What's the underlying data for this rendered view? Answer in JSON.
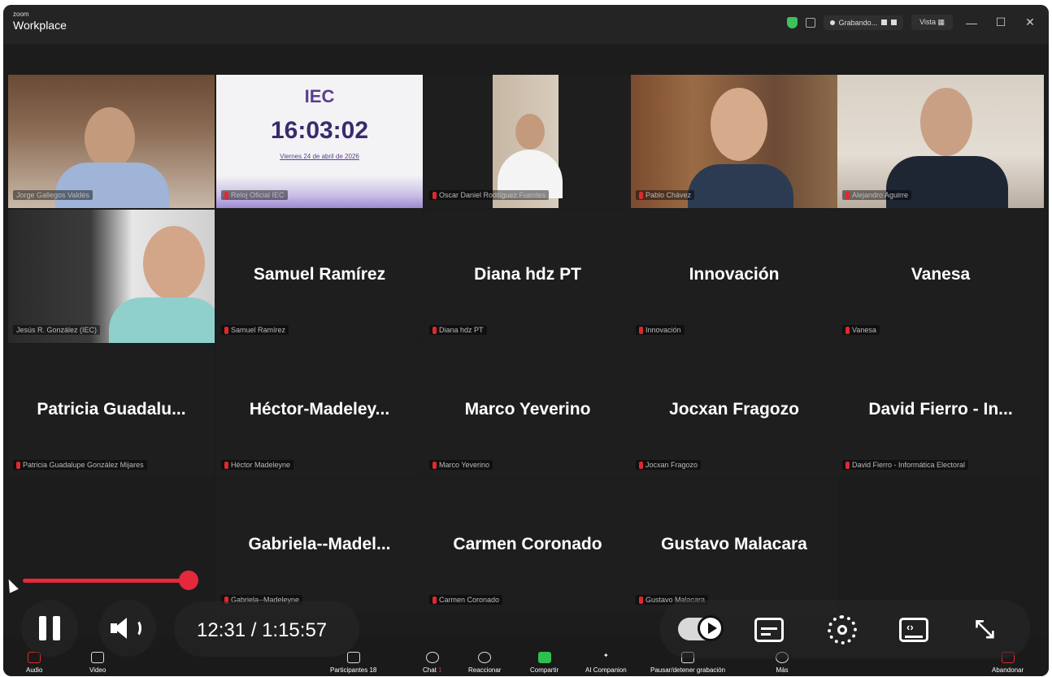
{
  "app": {
    "brand_small": "zoom",
    "brand_name": "Workplace"
  },
  "titlebar": {
    "recording_label": "Grabando...",
    "view_label": "Vista",
    "minimize": "—",
    "maximize": "☐",
    "close": "✕"
  },
  "tiles": [
    {
      "label": "Jorge Gallegos Valdés"
    },
    {
      "label": "Reloj Oficial IEC"
    },
    {
      "label": "Oscar Daniel Rodríguez Fuentes"
    },
    {
      "label": "Pablo Chávez"
    },
    {
      "label": "Alejandro Aguirre"
    },
    {
      "label": "Jesús R. González (IEC)"
    },
    {
      "name": "Samuel Ramírez",
      "label": "Samuel Ramírez"
    },
    {
      "name": "Diana hdz PT",
      "label": "Diana hdz PT"
    },
    {
      "name": "Innovación",
      "label": "Innovación"
    },
    {
      "name": "Vanesa",
      "label": "Vanesa"
    },
    {
      "name": "Patricia  Guadalu...",
      "label": "Patricia Guadalupe González Mijares"
    },
    {
      "name": "Héctor-Madeley...",
      "label": "Héctor Madeleyne"
    },
    {
      "name": "Marco Yeverino",
      "label": "Marco Yeverino"
    },
    {
      "name": "Jocxan Fragozo",
      "label": "Jocxan Fragozo"
    },
    {
      "name": "David Fierro - In...",
      "label": "David Fierro - Informática Electoral"
    },
    {
      "name": "Gabriela--Madel...",
      "label": "Gabriela--Madeleyne"
    },
    {
      "name": "Carmen Coronado",
      "label": "Carmen Coronado"
    },
    {
      "name": "Gustavo Malacara",
      "label": "Gustavo Malacara"
    }
  ],
  "iec_clock": {
    "logo": "IEC",
    "time": "16:03:02",
    "date": "Viernes 24 de abril de 2026"
  },
  "zoom_toolbar": {
    "audio": "Audio",
    "video": "Video",
    "participants": "Participantes",
    "participants_count": "18",
    "chat": "Chat",
    "chat_badge": "1",
    "react": "Reaccionar",
    "share": "Compartir",
    "ai": "AI Companion",
    "record": "Pausar/detener grabación",
    "more": "Más",
    "leave": "Abandonar"
  },
  "player": {
    "time": "12:31 / 1:15:57",
    "progress": 0.17,
    "accent": "#e5283c"
  }
}
